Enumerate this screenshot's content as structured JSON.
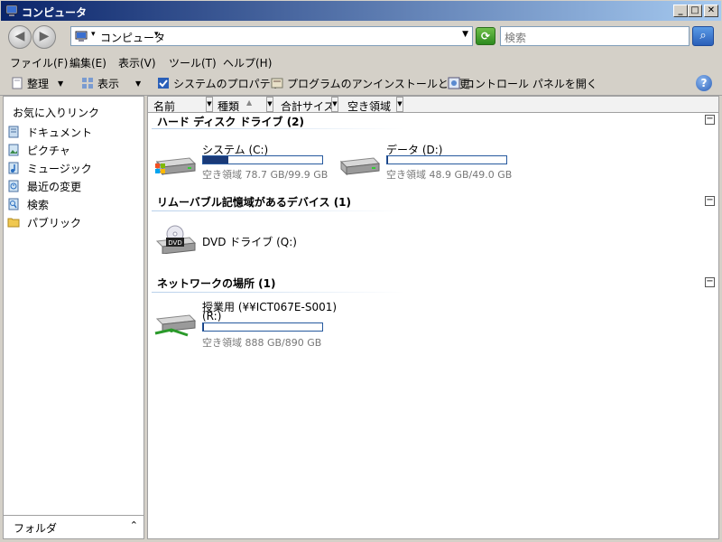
{
  "window": {
    "title": "コンピュータ"
  },
  "address": {
    "crumb": "コンピュータ",
    "search_placeholder": "検索"
  },
  "menu": {
    "items": [
      "ファイル(F)",
      "編集(E)",
      "表示(V)",
      "ツール(T)",
      "ヘルプ(H)"
    ]
  },
  "toolbar": {
    "organize": "整理",
    "view": "表示",
    "system_properties": "システムのプロパティ",
    "uninstall": "プログラムのアンインストールと変更",
    "control_panel": "コントロール パネルを開く"
  },
  "nav": {
    "favorites_title": "お気に入りリンク",
    "items": [
      {
        "label": "ドキュメント",
        "icon": "document-icon"
      },
      {
        "label": "ピクチャ",
        "icon": "pictures-icon"
      },
      {
        "label": "ミュージック",
        "icon": "music-icon"
      },
      {
        "label": "最近の変更",
        "icon": "recent-icon"
      },
      {
        "label": "検索",
        "icon": "search-icon"
      },
      {
        "label": "パブリック",
        "icon": "public-folder-icon"
      }
    ],
    "folders_label": "フォルダ"
  },
  "columns": [
    "名前",
    "種類",
    "合計サイズ",
    "空き領域"
  ],
  "groups": {
    "hdd": {
      "title": "ハード ディスク ドライブ (2)",
      "drives": [
        {
          "name": "システム (C:)",
          "free": "空き領域 78.7 GB/99.9 GB",
          "used_fraction": 0.21
        },
        {
          "name": "データ (D:)",
          "free": "空き領域 48.9 GB/49.0 GB",
          "used_fraction": 0.002
        }
      ]
    },
    "removable": {
      "title": "リムーバブル記憶域があるデバイス (1)",
      "drives": [
        {
          "name": "DVD ドライブ (Q:)"
        }
      ]
    },
    "network": {
      "title": "ネットワークの場所 (1)",
      "drives": [
        {
          "name": "授業用 (¥¥ICT067E-S001)",
          "letter": "(R:)",
          "free": "空き領域 888 GB/890 GB",
          "used_fraction": 0.002
        }
      ]
    }
  },
  "colors": {
    "title_start": "#0a246a",
    "title_end": "#a6caf0",
    "bar_fill": "#1a3a78"
  }
}
